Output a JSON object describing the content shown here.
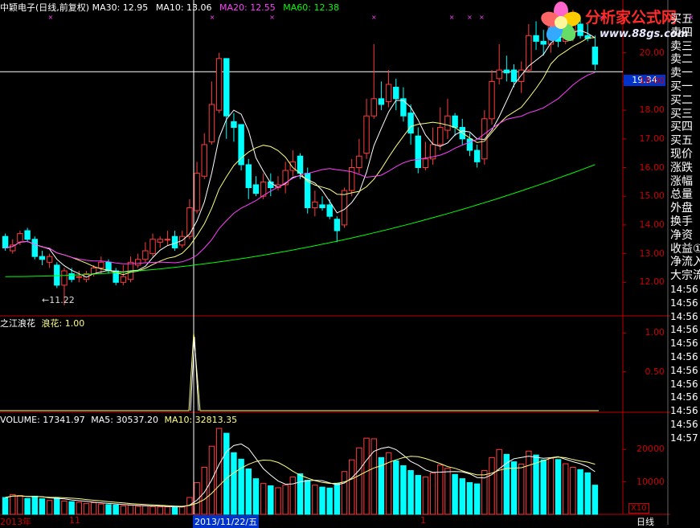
{
  "header": {
    "stock_title": "中颖电子(日线,前复权)",
    "ma30": "MA30: 12.95",
    "ma10": "MA10: 13.06",
    "ma20": "MA20: 12.55",
    "ma60": "MA60: 12.38",
    "indicator_title": "之江浪花",
    "indicator_value": "浪花: 1.00",
    "volume": "VOLUME: 17341.97",
    "vol_ma5": "MA5: 30537.20",
    "vol_ma10": "MA10: 32813.35"
  },
  "logo": {
    "text": "分析家公式网",
    "url": "www.88gs.com"
  },
  "crosshair_price": "19.34",
  "low_label": "11.22",
  "side_panel": [
    "买五",
    "卖四",
    "卖三",
    "卖二",
    "卖一",
    "买一",
    "买二",
    "买三",
    "买四",
    "买五",
    "现价",
    "涨跌",
    "涨幅",
    "总量",
    "外盘",
    "换手",
    "净资",
    "收益①",
    "净流入",
    "大宗流",
    "14:56",
    "14:56",
    "14:56",
    "14:56",
    "14:56",
    "14:56",
    "14:56",
    "14:56",
    "14:56",
    "14:56",
    "14:56",
    "14:57"
  ],
  "bottom": {
    "left": "2013年",
    "mid1": "11",
    "crosshair_date": "2013/11/22/五",
    "mid2": "1",
    "right": "日线",
    "x10": "X10"
  },
  "colors": {
    "up": "#ff3c3c",
    "down": "#00ffff",
    "ma_white": "#ffffff",
    "ma_yellow": "#ffff80",
    "ma_magenta": "#ff40ff",
    "ma_green": "#00ff00",
    "axis": "#c00000"
  },
  "chart_data": [
    {
      "type": "candlestick",
      "title": "中颖电子(日线,前复权)",
      "yticks": [
        12.0,
        13.0,
        14.0,
        15.0,
        16.0,
        17.0,
        18.0,
        19.0,
        20.0
      ],
      "ylim": [
        11.0,
        21.0
      ],
      "series": [
        {
          "name": "MA30",
          "values": [
            12.95
          ]
        },
        {
          "name": "MA10",
          "values": [
            13.06
          ]
        },
        {
          "name": "MA20",
          "values": [
            12.55
          ]
        },
        {
          "name": "MA60",
          "values": [
            12.38
          ]
        }
      ],
      "candles": [
        [
          13.6,
          13.2,
          13.7,
          13.1
        ],
        [
          13.1,
          13.3,
          13.5,
          13.0
        ],
        [
          13.4,
          13.7,
          13.8,
          13.3
        ],
        [
          13.8,
          13.5,
          13.9,
          13.4
        ],
        [
          13.5,
          12.9,
          13.6,
          12.8
        ],
        [
          12.9,
          12.8,
          13.1,
          12.6
        ],
        [
          12.7,
          12.9,
          13.0,
          12.5
        ],
        [
          12.6,
          11.9,
          12.7,
          11.8
        ],
        [
          11.9,
          12.4,
          12.5,
          11.2
        ],
        [
          12.3,
          12.1,
          12.5,
          12.0
        ],
        [
          12.2,
          12.2,
          12.4,
          12.0
        ],
        [
          12.1,
          12.3,
          12.4,
          12.0
        ],
        [
          12.3,
          12.5,
          12.6,
          12.2
        ],
        [
          12.5,
          12.7,
          12.9,
          12.3
        ],
        [
          12.7,
          12.4,
          12.8,
          12.3
        ],
        [
          12.4,
          12.0,
          12.5,
          11.9
        ],
        [
          12.0,
          12.2,
          12.6,
          11.9
        ],
        [
          12.1,
          12.7,
          12.9,
          12.0
        ],
        [
          12.6,
          12.8,
          13.0,
          12.5
        ],
        [
          12.8,
          13.1,
          13.4,
          12.7
        ],
        [
          13.0,
          13.5,
          13.7,
          12.9
        ],
        [
          13.4,
          13.5,
          13.6,
          13.2
        ],
        [
          13.5,
          13.5,
          13.8,
          13.3
        ],
        [
          13.6,
          13.2,
          13.8,
          13.1
        ],
        [
          13.3,
          13.6,
          13.8,
          13.2
        ],
        [
          13.6,
          14.6,
          14.9,
          13.5
        ],
        [
          14.5,
          15.8,
          16.2,
          14.4
        ],
        [
          15.7,
          16.8,
          17.2,
          15.6
        ],
        [
          16.9,
          18.2,
          19.0,
          16.8
        ],
        [
          18.0,
          19.8,
          20.0,
          17.9
        ],
        [
          19.8,
          17.8,
          18.0,
          17.0
        ],
        [
          17.6,
          17.4,
          17.9,
          16.9
        ],
        [
          17.5,
          16.1,
          17.5,
          15.9
        ],
        [
          16.1,
          15.3,
          16.3,
          14.9
        ],
        [
          15.4,
          15.1,
          15.7,
          15.0
        ],
        [
          15.0,
          15.5,
          15.8,
          14.9
        ],
        [
          15.5,
          15.3,
          15.8,
          15.0
        ],
        [
          15.3,
          15.4,
          15.7,
          15.2
        ],
        [
          15.4,
          15.9,
          16.2,
          15.1
        ],
        [
          15.9,
          16.2,
          16.6,
          15.7
        ],
        [
          16.4,
          15.8,
          16.5,
          15.6
        ],
        [
          15.8,
          14.6,
          16.0,
          14.4
        ],
        [
          14.6,
          14.8,
          15.2,
          14.3
        ],
        [
          14.7,
          14.6,
          15.0,
          14.5
        ],
        [
          14.7,
          14.3,
          14.9,
          14.2
        ],
        [
          14.2,
          13.8,
          14.3,
          13.4
        ],
        [
          14.0,
          15.2,
          15.3,
          13.9
        ],
        [
          15.2,
          16.0,
          16.3,
          15.0
        ],
        [
          16.0,
          16.4,
          17.0,
          15.8
        ],
        [
          16.5,
          17.8,
          18.4,
          16.3
        ],
        [
          17.8,
          18.4,
          20.3,
          17.7
        ],
        [
          18.4,
          18.2,
          19.0,
          18.0
        ],
        [
          18.3,
          18.9,
          19.4,
          18.1
        ],
        [
          18.8,
          18.4,
          19.1,
          18.0
        ],
        [
          18.4,
          17.8,
          18.8,
          17.6
        ],
        [
          17.9,
          17.2,
          18.2,
          16.8
        ],
        [
          17.1,
          16.0,
          17.4,
          15.8
        ],
        [
          16.0,
          16.3,
          16.9,
          15.9
        ],
        [
          16.3,
          16.8,
          17.4,
          16.1
        ],
        [
          16.8,
          17.4,
          18.1,
          16.6
        ],
        [
          17.3,
          17.8,
          18.4,
          17.0
        ],
        [
          17.8,
          17.4,
          17.9,
          17.1
        ],
        [
          17.4,
          17.0,
          17.7,
          16.8
        ],
        [
          17.0,
          16.6,
          17.2,
          16.4
        ],
        [
          16.6,
          16.2,
          16.8,
          16.0
        ],
        [
          16.3,
          17.7,
          18.0,
          16.1
        ],
        [
          17.7,
          19.0,
          19.4,
          17.5
        ],
        [
          19.1,
          19.4,
          20.3,
          18.9
        ],
        [
          19.4,
          19.3,
          19.9,
          19.0
        ],
        [
          19.4,
          19.0,
          19.6,
          18.8
        ],
        [
          19.0,
          19.4,
          19.7,
          18.6
        ],
        [
          19.4,
          20.6,
          21.0,
          19.3
        ],
        [
          20.6,
          20.4,
          21.1,
          20.1
        ],
        [
          20.4,
          20.3,
          20.8,
          19.9
        ],
        [
          20.3,
          21.0,
          21.2,
          20.0
        ],
        [
          21.0,
          20.4,
          21.2,
          20.2
        ],
        [
          20.4,
          20.7,
          21.0,
          20.3
        ],
        [
          20.7,
          21.2,
          21.5,
          20.4
        ],
        [
          21.0,
          20.6,
          21.2,
          20.5
        ],
        [
          20.6,
          20.5,
          21.0,
          20.4
        ],
        [
          20.2,
          19.6,
          20.6,
          19.4
        ]
      ]
    },
    {
      "type": "line",
      "title": "之江浪花",
      "series": [
        {
          "name": "浪花",
          "values": [
            1.0
          ]
        }
      ],
      "yticks": [
        0.5,
        1.0
      ],
      "ylim": [
        0.0,
        1.2
      ]
    },
    {
      "type": "bar",
      "title": "VOLUME",
      "series": [
        {
          "name": "VOLUME",
          "values": [
            17341.97
          ]
        },
        {
          "name": "MA5",
          "values": [
            30537.2
          ]
        },
        {
          "name": "MA10",
          "values": [
            32813.35
          ]
        }
      ],
      "yticks": [
        10000,
        20000
      ],
      "ylim": [
        0,
        28000
      ],
      "volumes": [
        5200,
        6100,
        5800,
        4900,
        5600,
        4800,
        4300,
        5100,
        4100,
        3900,
        3700,
        3400,
        3600,
        3200,
        3000,
        2900,
        2600,
        2800,
        2500,
        2600,
        2400,
        2300,
        2300,
        2200,
        2300,
        5200,
        9800,
        14500,
        21000,
        26500,
        25000,
        19000,
        17000,
        14000,
        11000,
        9500,
        8800,
        8200,
        9000,
        11500,
        12500,
        10500,
        9000,
        8400,
        8100,
        9600,
        13200,
        16800,
        20500,
        23500,
        23300,
        17500,
        19000,
        16500,
        15000,
        13500,
        12000,
        11500,
        12800,
        15200,
        14200,
        12300,
        11000,
        9800,
        9400,
        13500,
        17500,
        20000,
        18500,
        16200,
        15500,
        19500,
        18300,
        16800,
        17300,
        16900,
        15600,
        14500,
        13800,
        12800,
        9000
      ]
    }
  ]
}
